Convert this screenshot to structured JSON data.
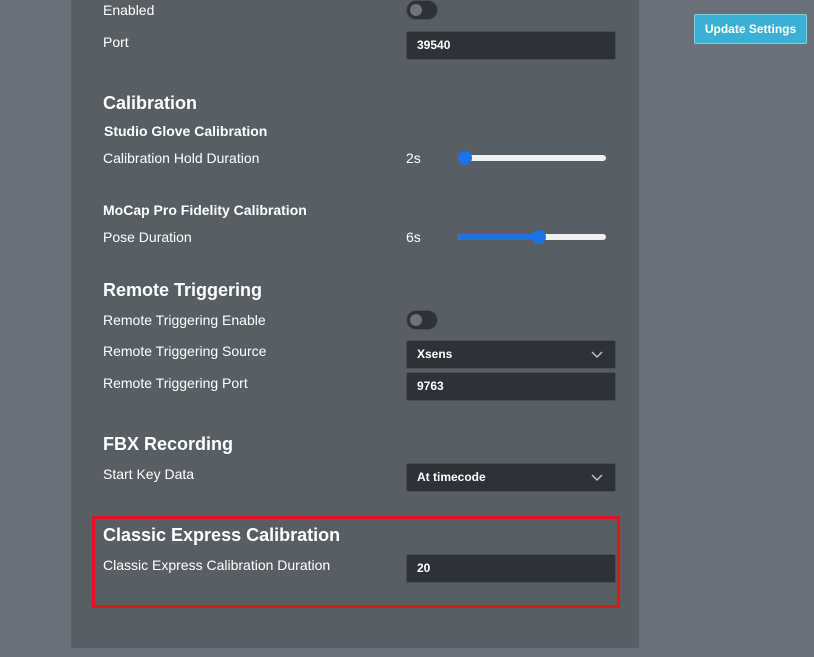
{
  "header_action": {
    "update_label": "Update Settings"
  },
  "streaming": {
    "enabled_label": "Enabled",
    "enabled_on": false,
    "port_label": "Port",
    "port_value": "39540"
  },
  "calibration": {
    "title": "Calibration",
    "studio_glove": {
      "title": "Studio Glove Calibration",
      "hold_label": "Calibration Hold Duration",
      "hold_value_text": "2s",
      "hold_level": 0.0
    },
    "mocap_pro": {
      "title": "MoCap Pro Fidelity Calibration",
      "pose_label": "Pose Duration",
      "pose_value_text": "6s",
      "pose_level": 0.55
    }
  },
  "remote_triggering": {
    "title": "Remote Triggering",
    "enable_label": "Remote Triggering Enable",
    "enable_on": false,
    "source_label": "Remote Triggering Source",
    "source_value": "Xsens",
    "port_label": "Remote Triggering Port",
    "port_value": "9763"
  },
  "fbx_recording": {
    "title": "FBX Recording",
    "start_key_label": "Start Key Data",
    "start_key_value": "At timecode"
  },
  "classic_express": {
    "title": "Classic Express Calibration",
    "duration_label": "Classic Express Calibration Duration",
    "duration_value": "20"
  },
  "colors": {
    "page_bg": "#6b7078",
    "panel_bg": "#595e64",
    "field_bg": "#2e3238",
    "accent_blue": "#1a73e8",
    "button_bg": "#3ab0d4",
    "highlight_red": "#e8101a"
  },
  "icons": {
    "dropdown": "chevron-down-icon"
  }
}
